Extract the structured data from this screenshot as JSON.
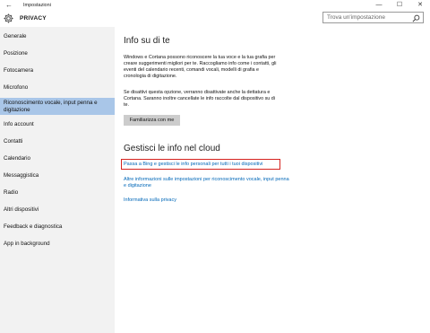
{
  "window": {
    "back_glyph": "←",
    "title": "Impostazioni",
    "minimize_glyph": "—",
    "maximize_glyph": "☐",
    "close_glyph": "✕"
  },
  "header": {
    "icon": "gear-icon",
    "title": "PRIVACY"
  },
  "search": {
    "placeholder": "Trova un'impostazione",
    "icon": "search-icon"
  },
  "sidebar": {
    "items": [
      {
        "label": "Generale",
        "selected": false
      },
      {
        "label": "Posizione",
        "selected": false
      },
      {
        "label": "Fotocamera",
        "selected": false
      },
      {
        "label": "Microfono",
        "selected": false
      },
      {
        "label": "Riconoscimento vocale, input penna e digitazione",
        "selected": true
      },
      {
        "label": "Info account",
        "selected": false
      },
      {
        "label": "Contatti",
        "selected": false
      },
      {
        "label": "Calendario",
        "selected": false
      },
      {
        "label": "Messaggistica",
        "selected": false
      },
      {
        "label": "Radio",
        "selected": false
      },
      {
        "label": "Altri dispositivi",
        "selected": false
      },
      {
        "label": "Feedback e diagnostica",
        "selected": false
      },
      {
        "label": "App in background",
        "selected": false
      }
    ]
  },
  "main": {
    "section1_title": "Info su di te",
    "para1": "Windows e Cortana possono riconoscere la tua voce e la tua grafia per creare suggerimenti migliori per te. Raccogliamo info come i contatti, gli eventi del calendario recenti, comandi vocali, modelli di grafia e cronologia di digitazione.",
    "para2": "Se disattivi questa opzione, verranno disattivate anche la dettatura e Cortana. Saranno inoltre cancellate le info raccolte dal dispositivo su di te.",
    "button_label": "Familiarizza con me",
    "section2_title": "Gestisci le info nel cloud",
    "link1": "Passa a Bing e gestisci le info personali per tutti i tuoi dispositivi",
    "link2": "Altre informazioni sulle impostazioni per riconoscimento vocale, input penna e digitazione",
    "link3": "Informativa sulla privacy"
  },
  "colors": {
    "accent": "#0067b8",
    "selected_bg": "#a9c6e8",
    "highlight_border": "#d6231f",
    "sidebar_bg": "#f2f2f2"
  }
}
